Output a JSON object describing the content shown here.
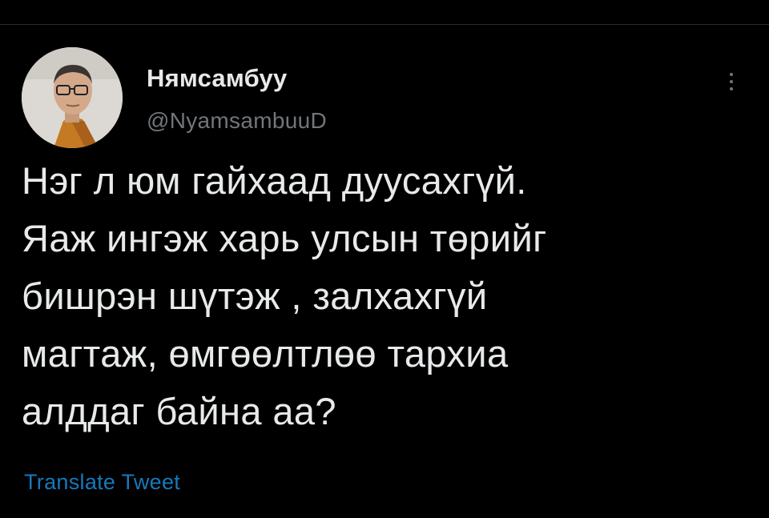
{
  "user": {
    "display_name": "Нямсамбуу",
    "handle": "@NyamsambuuD"
  },
  "tweet": {
    "text_lines": [
      "Нэг л юм гайхаад дуусахгүй.",
      "Яаж ингэж харь улсын төрийг",
      "бишрэн шүтэж , залхахгүй",
      "магтаж, өмгөөлтлөө тархиа",
      "алддаг байна аа?"
    ]
  },
  "actions": {
    "translate_label": "Translate Tweet",
    "more_icon": "more-vertical-icon"
  },
  "colors": {
    "background": "#000000",
    "text_primary": "#e7e9ea",
    "text_secondary": "#71767b",
    "link": "#1d9bf0"
  }
}
